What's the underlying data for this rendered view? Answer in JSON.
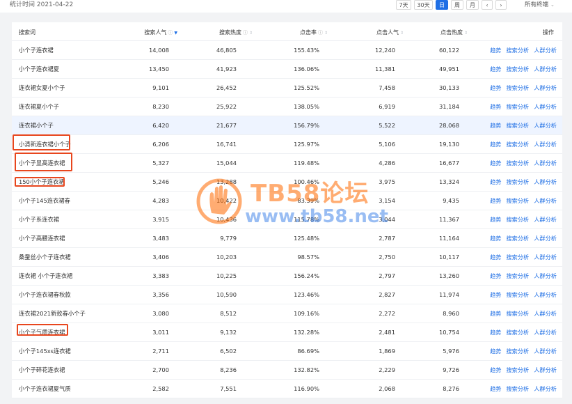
{
  "stat_time": "统计时间 2021-04-22",
  "periods": [
    "7天",
    "30天",
    "日",
    "周",
    "月"
  ],
  "active_period": "日",
  "terminal_filter": "所有终端",
  "columns": {
    "keyword": "搜索词",
    "popularity": "搜索人气",
    "heat": "搜索热度",
    "ctr": "点击率",
    "click_pop": "点击人气",
    "click_heat": "点击热度",
    "ops": "操作"
  },
  "actions": [
    "趋势",
    "搜索分析",
    "人群分析"
  ],
  "rows": [
    {
      "kw": "小个子连衣裙",
      "p": "14,008",
      "h": "46,805",
      "ctr": "155.43%",
      "cp": "12,240",
      "ch": "60,122"
    },
    {
      "kw": "小个子连衣裙夏",
      "p": "13,450",
      "h": "41,923",
      "ctr": "136.06%",
      "cp": "11,381",
      "ch": "49,951"
    },
    {
      "kw": "连衣裙女夏小个子",
      "p": "9,101",
      "h": "26,452",
      "ctr": "125.52%",
      "cp": "7,458",
      "ch": "30,133"
    },
    {
      "kw": "连衣裙夏小个子",
      "p": "8,230",
      "h": "25,922",
      "ctr": "138.05%",
      "cp": "6,919",
      "ch": "31,184"
    },
    {
      "kw": "连衣裙小个子",
      "p": "6,420",
      "h": "21,677",
      "ctr": "156.79%",
      "cp": "5,522",
      "ch": "28,068"
    },
    {
      "kw": "小清新连衣裙小个子",
      "p": "6,206",
      "h": "16,741",
      "ctr": "125.97%",
      "cp": "5,106",
      "ch": "19,130"
    },
    {
      "kw": "小个子显高连衣裙",
      "p": "5,327",
      "h": "15,044",
      "ctr": "119.48%",
      "cp": "4,286",
      "ch": "16,677"
    },
    {
      "kw": "150小个子连衣裙",
      "p": "5,246",
      "h": "13,288",
      "ctr": "100.46%",
      "cp": "3,975",
      "ch": "13,324"
    },
    {
      "kw": "小个子145连衣裙春",
      "p": "4,283",
      "h": "10,422",
      "ctr": "83.39%",
      "cp": "3,154",
      "ch": "9,435"
    },
    {
      "kw": "小个子系连衣裙",
      "p": "3,915",
      "h": "10,436",
      "ctr": "115.78%",
      "cp": "3,044",
      "ch": "11,367"
    },
    {
      "kw": "小个子高腰连衣裙",
      "p": "3,483",
      "h": "9,779",
      "ctr": "125.48%",
      "cp": "2,787",
      "ch": "11,164"
    },
    {
      "kw": "桑蚕丝小个子连衣裙",
      "p": "3,406",
      "h": "10,203",
      "ctr": "98.57%",
      "cp": "2,750",
      "ch": "10,117"
    },
    {
      "kw": "连衣裙 小个子连衣裙",
      "p": "3,383",
      "h": "10,225",
      "ctr": "156.24%",
      "cp": "2,797",
      "ch": "13,260"
    },
    {
      "kw": "小个子连衣裙春秋款",
      "p": "3,356",
      "h": "10,590",
      "ctr": "123.46%",
      "cp": "2,827",
      "ch": "11,974"
    },
    {
      "kw": "连衣裙2021新款春小个子",
      "p": "3,080",
      "h": "8,512",
      "ctr": "109.16%",
      "cp": "2,272",
      "ch": "8,960"
    },
    {
      "kw": "小个子气质连衣裙",
      "p": "3,011",
      "h": "9,132",
      "ctr": "132.28%",
      "cp": "2,481",
      "ch": "10,754"
    },
    {
      "kw": "小个子145xs连衣裙",
      "p": "2,711",
      "h": "6,502",
      "ctr": "86.69%",
      "cp": "1,869",
      "ch": "5,976"
    },
    {
      "kw": "小个子碎花连衣裙",
      "p": "2,700",
      "h": "8,236",
      "ctr": "132.82%",
      "cp": "2,229",
      "ch": "9,726"
    },
    {
      "kw": "小个子连衣裙夏气质",
      "p": "2,582",
      "h": "7,551",
      "ctr": "116.90%",
      "cp": "2,068",
      "ch": "8,276"
    }
  ],
  "highlighted_row": 4,
  "watermark": {
    "title": "TB58论坛",
    "url": "www.tb58.net"
  },
  "colors": {
    "accent": "#1f6fe5",
    "annotation": "#e8461d",
    "highlight_row": "#eef4ff",
    "watermark_orange": "#ff6a00"
  }
}
